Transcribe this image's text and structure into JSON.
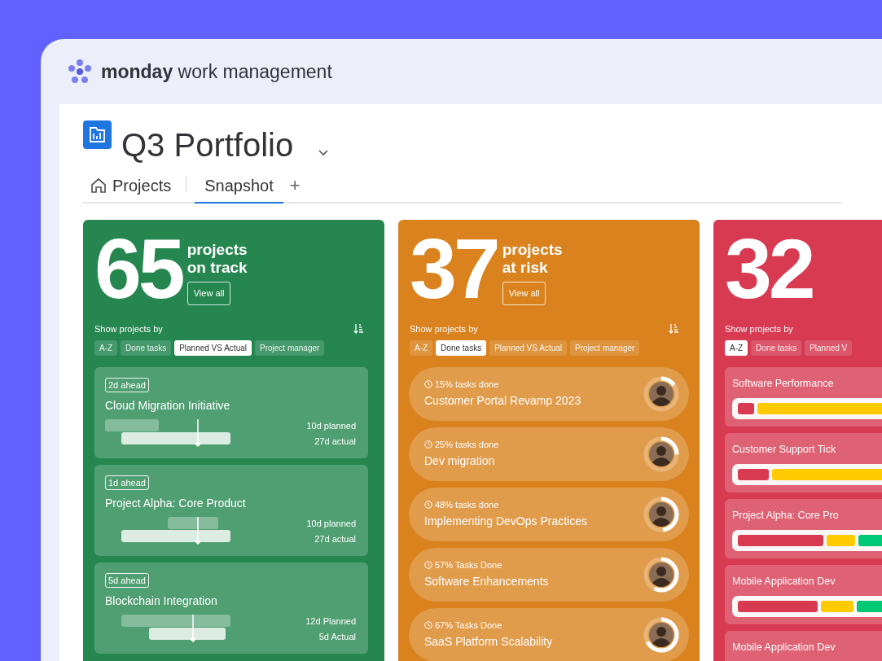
{
  "app": {
    "brand": "**monday** work management"
  },
  "board": {
    "title": "Q3 Portfolio"
  },
  "tabs": [
    {
      "label": "Projects",
      "kind": "home",
      "selected": false
    },
    {
      "label": "Snapshot",
      "kind": "plain",
      "selected": true
    }
  ],
  "add_tab": "+",
  "columns": [
    {
      "kind": "timeline",
      "color": "#25874f",
      "count": "65",
      "label": "projects",
      "label_2": "on track",
      "view_all": "View all",
      "show_by": "Show projects by",
      "filters": [
        {
          "label": "A-Z",
          "selected": false
        },
        {
          "label": "Done tasks",
          "selected": false
        },
        {
          "label": "Planned VS Actual",
          "selected": true
        },
        {
          "label": "Project manager",
          "selected": false
        }
      ],
      "items": [
        {
          "badge": "2d ahead",
          "name": "Cloud Migration Initiative",
          "planned": "10d planned",
          "actual": "27d actual"
        },
        {
          "badge": "1d ahead",
          "name": "Project Alpha: Core Product",
          "planned": "10d planned",
          "actual": "27d actual"
        },
        {
          "badge": "5d ahead",
          "name": "Blockchain Integration",
          "planned": "12d Planned",
          "actual": "5d Actual"
        }
      ]
    },
    {
      "kind": "progress",
      "color": "#d9821e",
      "count": "37",
      "label": "projects",
      "label_2": "at risk",
      "view_all": "View all",
      "show_by": "Show projects by",
      "filters": [
        {
          "label": "A-Z",
          "selected": false
        },
        {
          "label": "Done tasks",
          "selected": true
        },
        {
          "label": "Planned VS Actual",
          "selected": false
        },
        {
          "label": "Project manager",
          "selected": false
        }
      ],
      "items": [
        {
          "done": "15% tasks done",
          "name": "Customer Portal Revamp 2023"
        },
        {
          "done": "25% tasks done",
          "name": "Dev migration"
        },
        {
          "done": "48% tasks done",
          "name": "Implementing DevOps Practices"
        },
        {
          "done": "57% Tasks Done",
          "name": "Software Enhancements"
        },
        {
          "done": "67% Tasks Done",
          "name": "SaaS Platform Scalability"
        }
      ]
    },
    {
      "kind": "status",
      "color": "#d83a52",
      "count": "32",
      "show_by": "Show projects by",
      "filters": [
        {
          "label": "A-Z",
          "selected": true
        },
        {
          "label": "Done tasks",
          "selected": false
        },
        {
          "label": "Planned V",
          "selected": false
        }
      ],
      "items": [
        {
          "name": "Software Performance"
        },
        {
          "name": "Customer Support Tick"
        },
        {
          "name": "Project Alpha: Core Pro"
        },
        {
          "name": "Mobile Application Dev"
        },
        {
          "name": "Mobile Application Dev"
        }
      ]
    }
  ]
}
